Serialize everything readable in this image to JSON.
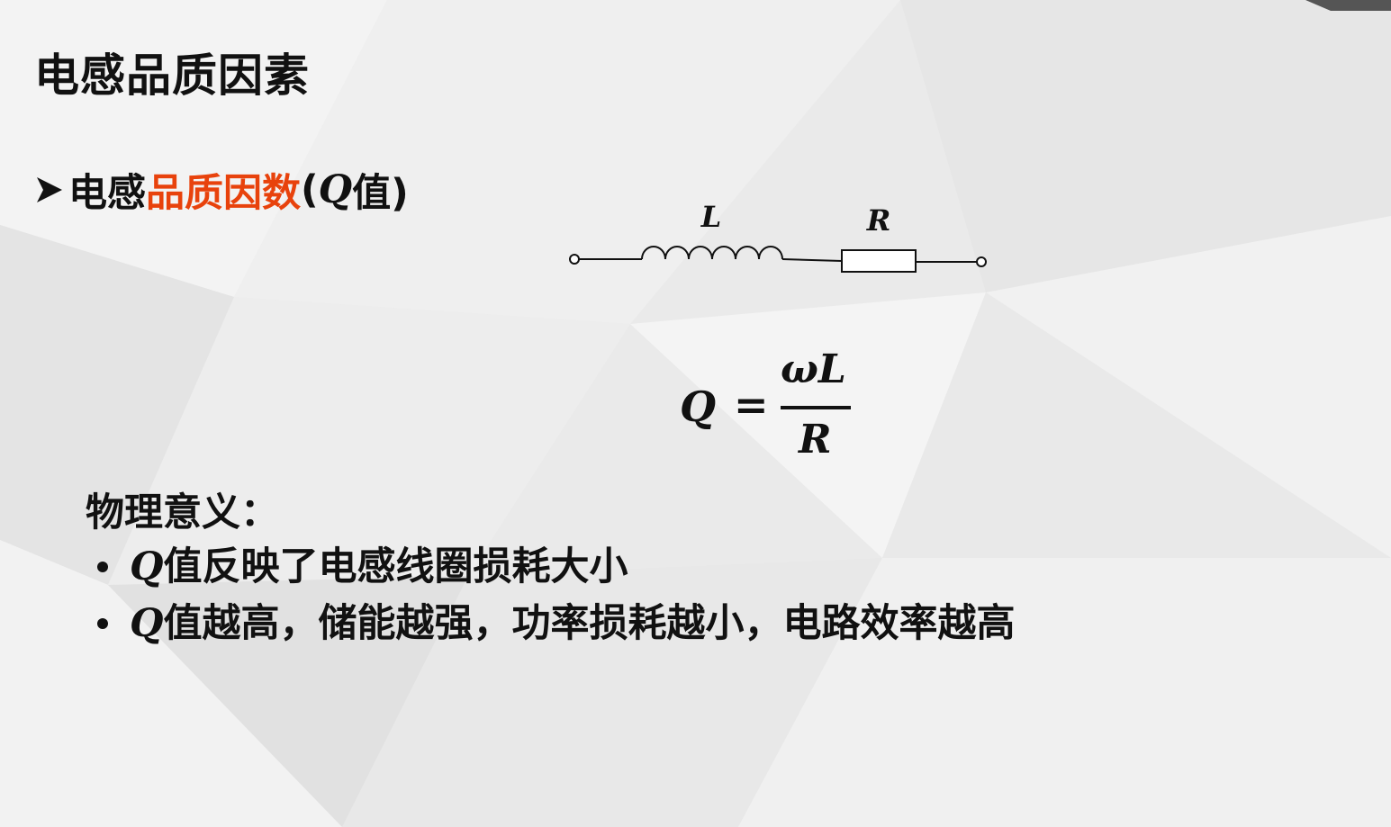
{
  "slide": {
    "title": "电感品质因素",
    "heading": {
      "prefix": "电感",
      "highlight": "品质因数",
      "open_paren": "(",
      "q": "Q",
      "suffix": "值)"
    },
    "circuit": {
      "inductor_label": "L",
      "resistor_label": "R"
    },
    "formula": {
      "lhs": "Q",
      "equals": "=",
      "numerator": "ωL",
      "denominator": "R"
    },
    "meaning": {
      "title": "物理意义：",
      "items": [
        {
          "q": "Q",
          "text": "值反映了电感线圈损耗大小"
        },
        {
          "q": "Q",
          "text": "值越高，储能越强，功率损耗越小，电路效率越高"
        }
      ]
    }
  },
  "colors": {
    "highlight": "#e8420c",
    "text": "#111111",
    "background": "#ececec"
  },
  "icons": {
    "heading_bullet": "arrow-bullet-icon",
    "list_bullet": "dot-bullet-icon"
  }
}
